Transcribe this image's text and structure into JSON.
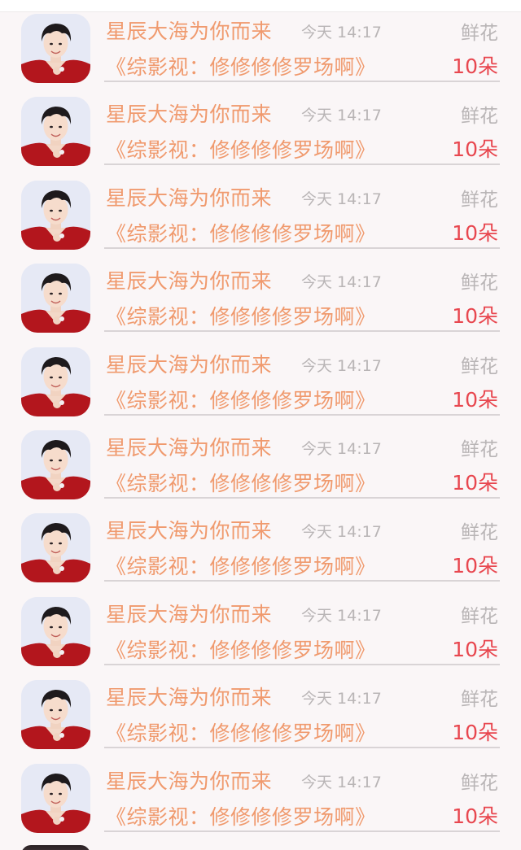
{
  "rows": [
    {
      "name": "星辰大海为你而来",
      "time": "今天 14:17",
      "gift_type": "鲜花",
      "work": "《综影视：修修修修罗场啊》",
      "count": "10朵"
    },
    {
      "name": "星辰大海为你而来",
      "time": "今天 14:17",
      "gift_type": "鲜花",
      "work": "《综影视：修修修修罗场啊》",
      "count": "10朵"
    },
    {
      "name": "星辰大海为你而来",
      "time": "今天 14:17",
      "gift_type": "鲜花",
      "work": "《综影视：修修修修罗场啊》",
      "count": "10朵"
    },
    {
      "name": "星辰大海为你而来",
      "time": "今天 14:17",
      "gift_type": "鲜花",
      "work": "《综影视：修修修修罗场啊》",
      "count": "10朵"
    },
    {
      "name": "星辰大海为你而来",
      "time": "今天 14:17",
      "gift_type": "鲜花",
      "work": "《综影视：修修修修罗场啊》",
      "count": "10朵"
    },
    {
      "name": "星辰大海为你而来",
      "time": "今天 14:17",
      "gift_type": "鲜花",
      "work": "《综影视：修修修修罗场啊》",
      "count": "10朵"
    },
    {
      "name": "星辰大海为你而来",
      "time": "今天 14:17",
      "gift_type": "鲜花",
      "work": "《综影视：修修修修罗场啊》",
      "count": "10朵"
    },
    {
      "name": "星辰大海为你而来",
      "time": "今天 14:17",
      "gift_type": "鲜花",
      "work": "《综影视：修修修修罗场啊》",
      "count": "10朵"
    },
    {
      "name": "星辰大海为你而来",
      "time": "今天 14:17",
      "gift_type": "鲜花",
      "work": "《综影视：修修修修罗场啊》",
      "count": "10朵"
    },
    {
      "name": "星辰大海为你而来",
      "time": "今天 14:17",
      "gift_type": "鲜花",
      "work": "《综影视：修修修修罗场啊》",
      "count": "10朵"
    }
  ],
  "colors": {
    "name": "#f09a6e",
    "meta": "#b9b5b6",
    "count": "#e8474f",
    "background": "#faf6f7"
  }
}
